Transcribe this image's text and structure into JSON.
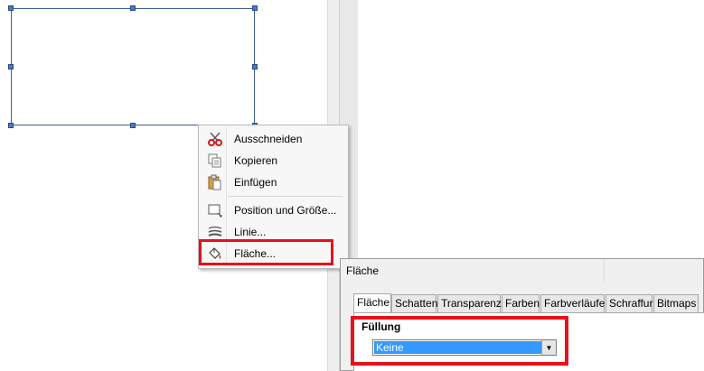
{
  "context_menu": {
    "items": [
      {
        "label": "Ausschneiden",
        "icon": "scissors-icon"
      },
      {
        "label": "Kopieren",
        "icon": "copy-icon"
      },
      {
        "label": "Einfügen",
        "icon": "paste-icon"
      },
      {
        "label": "Position und Größe...",
        "icon": "position-size-icon"
      },
      {
        "label": "Linie...",
        "icon": "line-icon"
      },
      {
        "label": "Fläche...",
        "icon": "fill-bucket-icon"
      }
    ]
  },
  "dialog": {
    "title": "Fläche",
    "tabs": [
      "Fläche",
      "Schatten",
      "Transparenz",
      "Farben",
      "Farbverläufe",
      "Schraffur",
      "Bitmaps"
    ],
    "active_tab": "Fläche",
    "section_label": "Füllung",
    "fill_select": {
      "value": "Keine"
    }
  },
  "colors": {
    "highlight": "#e8101a",
    "selection_blue": "#3399ff",
    "shape_border": "#3c5e99"
  }
}
